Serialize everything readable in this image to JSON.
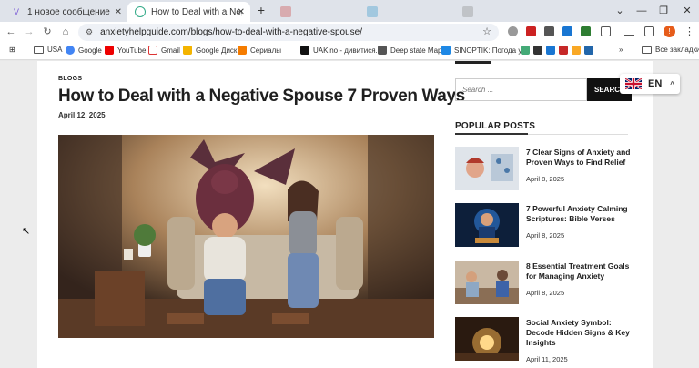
{
  "browser": {
    "tabs": [
      {
        "title": "1 новое сообщение",
        "active": false
      },
      {
        "title": "How to Deal with a Negative Spo",
        "active": true
      },
      {
        "title": "",
        "active": false
      },
      {
        "title": "",
        "active": false
      },
      {
        "title": "",
        "active": false
      }
    ],
    "url": "anxietyhelpguide.com/blogs/how-to-deal-with-a-negative-spouse/",
    "profile_initial": "!",
    "bookmarks": [
      "USA",
      "Google",
      "YouTube",
      "Gmail",
      "Google Диск",
      "Сериалы",
      "UAKino - дивитися...",
      "Deep state Map",
      "SINOPTIK: Погода у..."
    ],
    "all_bookmarks": "Все закладки"
  },
  "article": {
    "category": "BLOGS",
    "title": "How to Deal with a Negative Spouse 7 Proven Ways",
    "date": "April 12, 2025"
  },
  "sidebar": {
    "search_placeholder": "Search ...",
    "search_button": "SEARCH",
    "language": "EN",
    "popular_heading": "POPULAR POSTS",
    "posts": [
      {
        "title": "7 Clear Signs of Anxiety and Proven Ways to Find Relief",
        "date": "April 8, 2025"
      },
      {
        "title": "7 Powerful Anxiety Calming Scriptures: Bible Verses",
        "date": "April 8, 2025"
      },
      {
        "title": "8 Essential Treatment Goals for Managing Anxiety",
        "date": "April 8, 2025"
      },
      {
        "title": "Social Anxiety Symbol: Decode Hidden Signs & Key Insights",
        "date": "April 11, 2025"
      }
    ]
  },
  "colors": {
    "accent": "#1a1a1a",
    "tab_bar": "#dfe3ea"
  }
}
